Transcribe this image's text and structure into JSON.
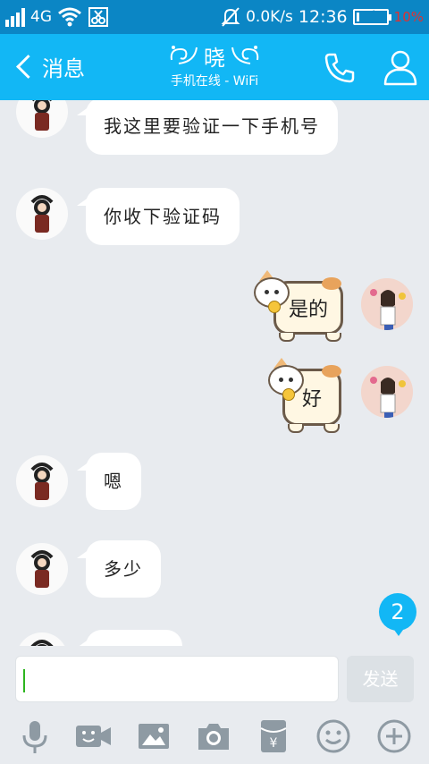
{
  "status_bar": {
    "network": "4G",
    "speed": "0.0K/s",
    "time": "12:36",
    "battery_pct": "10%",
    "battery_level": 0.1
  },
  "header": {
    "back_label": "消息",
    "contact_name": "晓",
    "contact_status": "手机在线 - WiFi"
  },
  "messages": [
    {
      "side": "left",
      "text": "我这里要验证一下手机号"
    },
    {
      "side": "left",
      "text": "你收下验证码"
    },
    {
      "side": "right",
      "text": "是的"
    },
    {
      "side": "right",
      "text": "好"
    },
    {
      "side": "left",
      "text": "嗯"
    },
    {
      "side": "left",
      "text": "多少"
    }
  ],
  "unread_count": "2",
  "input": {
    "value": "",
    "send_label": "发送"
  },
  "toolbar": [
    "mic-icon",
    "video-icon",
    "image-icon",
    "camera-icon",
    "red-packet-icon",
    "emoji-icon",
    "plus-icon"
  ],
  "colors": {
    "title_bar": "#12b7f5",
    "status_bar": "#0b86c5",
    "background": "#e8ebef",
    "icon_gray": "#8e9aa3"
  }
}
